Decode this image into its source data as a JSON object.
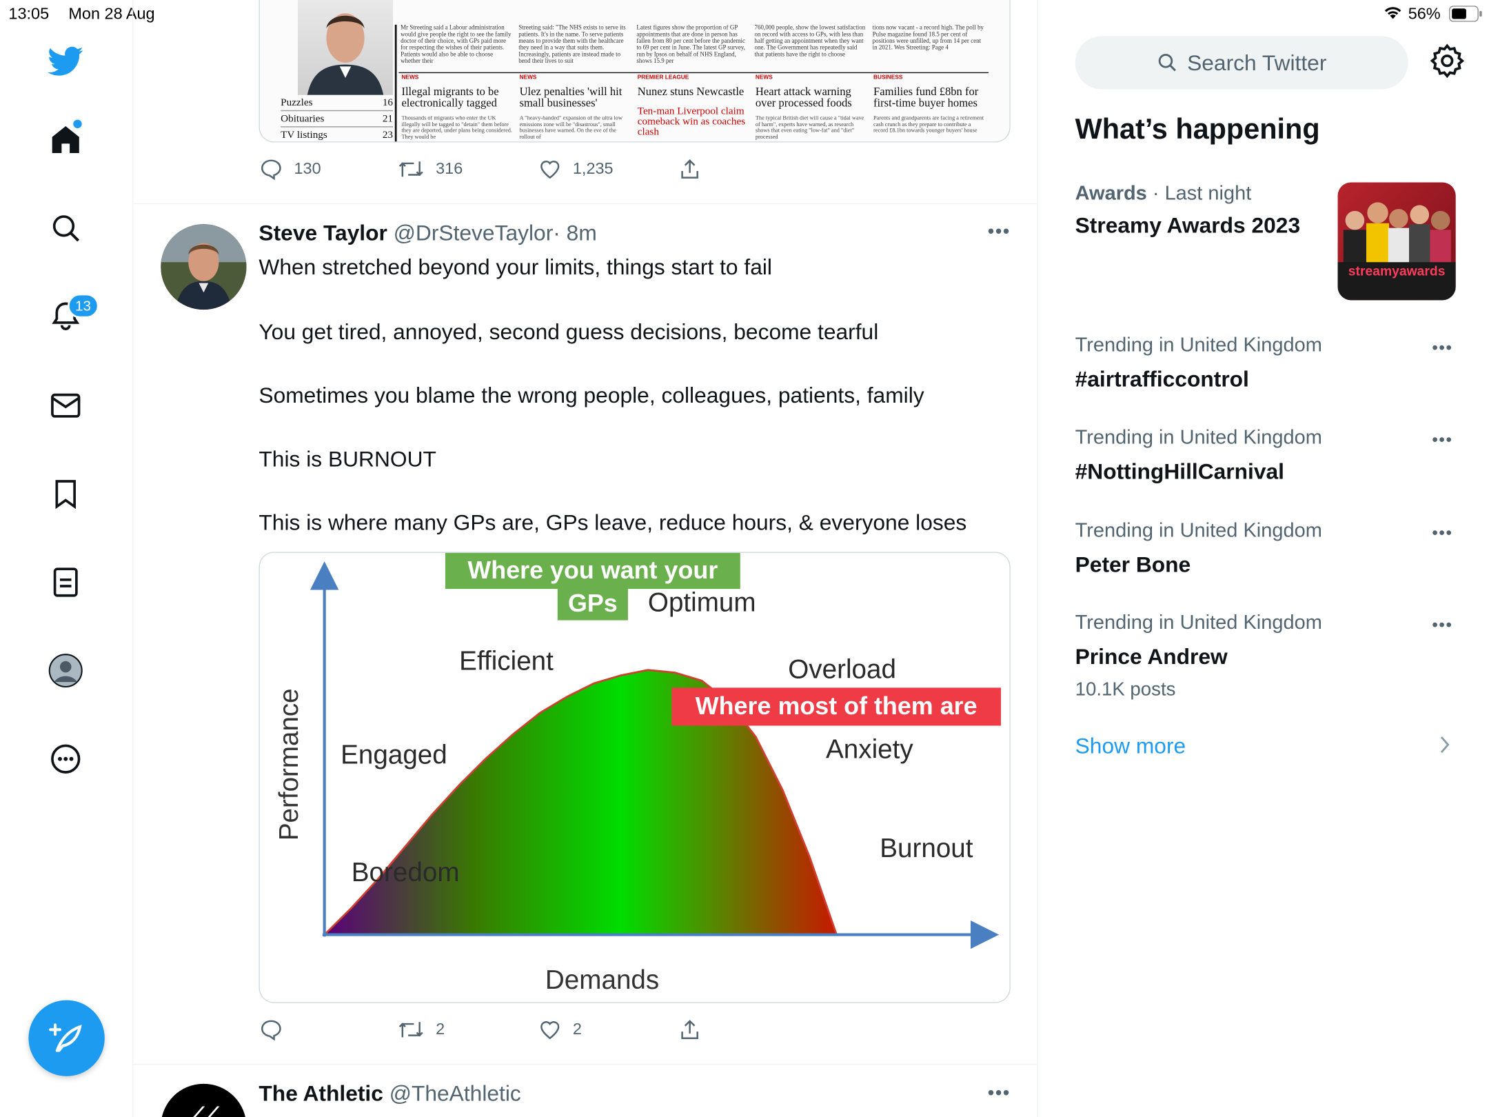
{
  "status_bar": {
    "time": "13:05",
    "date": "Mon 28 Aug",
    "battery": "56%"
  },
  "multitask_dots": "•••",
  "sidebar": {
    "notifications_count": "13"
  },
  "tweet1_image": {
    "columns": [
      "Mr Streeting said a Labour administration would give people the right to see the family doctor of their choice, with GPs paid more for respecting the wishes of their patients. Patients would also be able to choose whether their",
      "Streeting said: \"The NHS exists to serve its patients. It's in the name. To serve patients means to provide them with the healthcare they need in a way that suits them. Increasingly, patients are instead made to bend their lives to suit",
      "Latest figures show the proportion of GP appointments that are done in person has fallen from 80 per cent before the pandemic to 69 per cent in June. The latest GP survey, run by Ipsos on behalf of NHS England, shows 15.9 per",
      "760,000 people, show the lowest satisfaction on record with access to GPs, with less than half getting an appointment when they want one. The Government has repeatedly said that patients have the right to choose",
      "tions now vacant - a record high. The poll by Pulse magazine found 18.5 per cent of positions were unfilled, up from 14 per cent in 2021. Wes Streeting: Page 4"
    ],
    "index": [
      {
        "label": "Puzzles",
        "page": "16"
      },
      {
        "label": "Obituaries",
        "page": "21"
      },
      {
        "label": "TV listings",
        "page": "23"
      }
    ],
    "stories": [
      {
        "kicker": "NEWS",
        "headline": "Illegal migrants to be electronically tagged",
        "text": "Thousands of migrants who enter the UK illegally will be tagged to \"detain\" them before they are deported, under plans being considered. They would be"
      },
      {
        "kicker": "NEWS",
        "headline": "Ulez penalties 'will hit small businesses'",
        "text": "A \"heavy-handed\" expansion of the ultra low emissions zone will be \"disastrous\", small businesses have warned. On the eve of the rollout of"
      },
      {
        "kicker": "PREMIER LEAGUE",
        "headline": "Nunez stuns Newcastle",
        "subhead": "Ten-man Liverpool claim comeback win as coaches clash"
      },
      {
        "kicker": "NEWS",
        "headline": "Heart attack warning over processed foods",
        "text": "The typical British diet will cause a \"tidal wave of harm\", experts have warned, as research shows that even eating \"low-fat\" and \"diet\" processed"
      },
      {
        "kicker": "BUSINESS",
        "headline": "Families fund £8bn for first-time buyer homes",
        "text": "Parents and grandparents are facing a retirement cash crunch as they prepare to contribute a record £8.1bn towards younger buyers' house"
      }
    ]
  },
  "tweet1_actions": {
    "replies": "130",
    "retweets": "316",
    "likes": "1,235"
  },
  "tweet2": {
    "name": "Steve Taylor",
    "handle": "@DrSteveTaylor",
    "time": "· 8m",
    "lines": [
      "When stretched beyond your limits, things start to fail",
      "You get tired, annoyed, second guess decisions, become tearful",
      "Sometimes you blame the wrong people, colleagues, patients, family",
      "This is BURNOUT",
      "This is where many GPs are, GPs leave, reduce hours, & everyone loses"
    ],
    "actions": {
      "replies": "",
      "retweets": "2",
      "likes": "2"
    }
  },
  "chart_data": {
    "type": "area",
    "xlabel": "Demands",
    "ylabel": "Performance",
    "x": [
      0,
      5,
      10,
      15,
      20,
      25,
      30,
      35,
      40,
      45,
      50,
      55,
      60,
      65,
      70,
      75,
      80,
      85,
      90,
      95,
      100
    ],
    "y": [
      0,
      10,
      21,
      33,
      45,
      56,
      66,
      75,
      83,
      89,
      94,
      97,
      99,
      98,
      95,
      87,
      74,
      54,
      29,
      0,
      0
    ],
    "xlim": [
      0,
      120
    ],
    "ylim": [
      0,
      135
    ],
    "annotations": [
      {
        "text": "Boredom",
        "x": 5,
        "y": 20
      },
      {
        "text": "Engaged",
        "x": 3,
        "y": 64
      },
      {
        "text": "Efficient",
        "x": 25,
        "y": 99
      },
      {
        "text": "Optimum",
        "x": 60,
        "y": 121
      },
      {
        "text": "Overload",
        "x": 86,
        "y": 96
      },
      {
        "text": "Anxiety",
        "x": 93,
        "y": 66
      },
      {
        "text": "Burnout",
        "x": 103,
        "y": 29
      }
    ],
    "callouts": [
      {
        "text_lines": [
          "Where you want your",
          "GPs"
        ],
        "color": "#6ab04c"
      },
      {
        "text_lines": [
          "Where most of them are"
        ],
        "color": "#ee3b45"
      }
    ],
    "gradient_colors": [
      "#5a007a",
      "#3a7a00",
      "#00dd00",
      "#e00000"
    ]
  },
  "tweet3": {
    "name": "The Athletic",
    "handle": "@TheAthletic"
  },
  "right": {
    "search_placeholder": "Search Twitter",
    "heading": "What’s happening",
    "featured": {
      "category": "Awards",
      "time": " · Last night",
      "title": "Streamy Awards 2023",
      "image_text": "streamyawards"
    },
    "trends": [
      {
        "context": "Trending in United Kingdom",
        "title": "#airtrafficcontrol",
        "posts": ""
      },
      {
        "context": "Trending in United Kingdom",
        "title": "#NottingHillCarnival",
        "posts": ""
      },
      {
        "context": "Trending in United Kingdom",
        "title": "Peter Bone",
        "posts": ""
      },
      {
        "context": "Trending in United Kingdom",
        "title": "Prince Andrew",
        "posts": "10.1K posts"
      }
    ],
    "show_more": "Show more"
  },
  "colors": {
    "accent": "#1d9bf0",
    "text": "#0f1419",
    "muted": "#536471",
    "border": "#eff3f4"
  }
}
